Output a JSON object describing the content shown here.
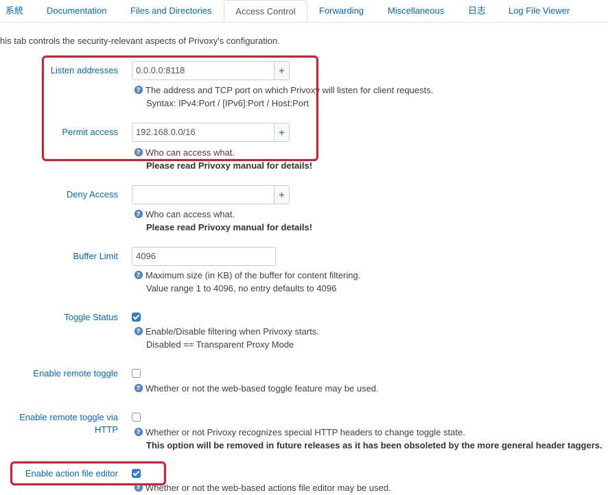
{
  "tabs": [
    {
      "label": "系統"
    },
    {
      "label": "Documentation"
    },
    {
      "label": "Files and Directories"
    },
    {
      "label": "Access Control",
      "active": true
    },
    {
      "label": "Forwarding"
    },
    {
      "label": "Miscellaneous"
    },
    {
      "label": "日志"
    },
    {
      "label": "Log File Viewer"
    }
  ],
  "intro": "his tab controls the security-relevant aspects of Privoxy's configuration.",
  "listen": {
    "label": "Listen addresses",
    "value": "0.0.0.0:8118",
    "add": "+",
    "desc1": "The address and TCP port on which Privoxy will listen for client requests.",
    "desc2": "Syntax: IPv4:Port / [IPv6]:Port / Host:Port"
  },
  "permit": {
    "label": "Permit access",
    "value": "192.168.0.0/16",
    "add": "+",
    "desc1": "Who can access what.",
    "desc2": "Please read Privoxy manual for details!"
  },
  "deny": {
    "label": "Deny Access",
    "value": "",
    "add": "+",
    "desc1": "Who can access what.",
    "desc2": "Please read Privoxy manual for details!"
  },
  "buffer": {
    "label": "Buffer Limit",
    "value": "4096",
    "desc1": "Maximum size (in KB) of the buffer for content filtering.",
    "desc2": "Value range 1 to 4096, no entry defaults to 4096"
  },
  "toggle_status": {
    "label": "Toggle Status",
    "checked": true,
    "desc1": "Enable/Disable filtering when Privoxy starts.",
    "desc2": "Disabled == Transparent Proxy Mode"
  },
  "remote_toggle": {
    "label": "Enable remote toggle",
    "checked": false,
    "desc1": "Whether or not the web-based toggle feature may be used."
  },
  "remote_toggle_http": {
    "label1": "Enable remote toggle via",
    "label2": "HTTP",
    "checked": false,
    "desc1": "Whether or not Privoxy recognizes special HTTP headers to change toggle state.",
    "desc2": "This option will be removed in future releases as it has been obsoleted by the more general header taggers."
  },
  "action_editor": {
    "label": "Enable action file editor",
    "checked": true,
    "desc1": "Whether or not the web-based actions file editor may be used."
  },
  "colors": {
    "accent": "#0069d6",
    "highlight": "#e0182d",
    "add_icon": "#3aa63a"
  }
}
